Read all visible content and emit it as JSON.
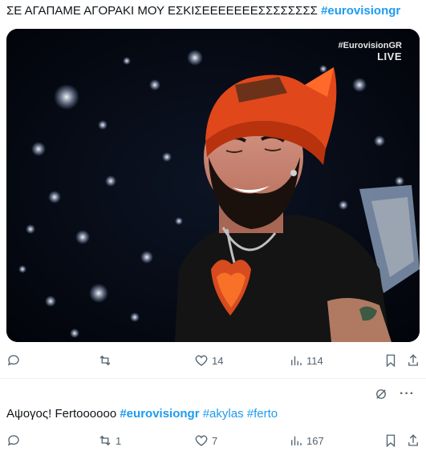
{
  "tweets": [
    {
      "text": "ΣΕ ΑΓΑΠΑΜΕ ΑΓΟΡΑΚΙ ΜΟΥ ΕΣΚΙΣΕΕΕΕΕΕΕΣΣΣΣΣΣΣΣ",
      "hashtags": [
        "#eurovisiongr"
      ],
      "media": {
        "watermark_brand": "#EurovisionGR",
        "watermark_live": "LIVE"
      },
      "actions": {
        "reply_count": "",
        "retweet_count": "",
        "like_count": "14",
        "views_count": "114"
      }
    },
    {
      "text": "Αψογος! Fertoooooo",
      "hashtags": [
        "#eurovisiongr",
        "#akylas",
        "#ferto"
      ],
      "actions": {
        "reply_count": "",
        "retweet_count": "1",
        "like_count": "7",
        "views_count": "167"
      }
    }
  ],
  "colors": {
    "accent": "#1d9bf0",
    "icon": "#536471",
    "text": "#0f1419"
  }
}
